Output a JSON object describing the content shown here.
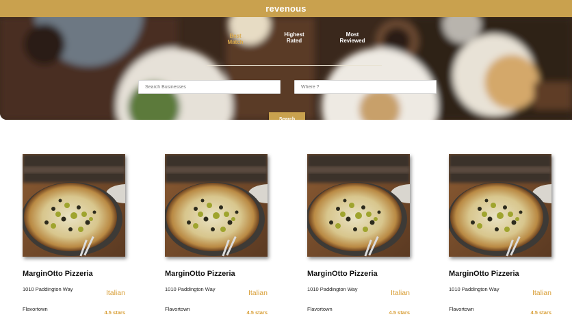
{
  "app": {
    "brand": "revenous"
  },
  "colors": {
    "accent": "#c9a14e",
    "active_tab": "#d9a84a",
    "cuisine": "#d9a03a"
  },
  "sort_tabs": [
    {
      "label": "Best\nMatch",
      "active": true
    },
    {
      "label": "Highest\nRated",
      "active": false
    },
    {
      "label": "Most\nReviewed",
      "active": false
    }
  ],
  "search": {
    "business_placeholder": "Search Businesses",
    "location_placeholder": "Where ?",
    "button_label": "Search"
  },
  "businesses": [
    {
      "name": "MarginOtto Pizzeria",
      "address": "1010 Paddington Way",
      "city": "Flavortown",
      "cuisine": "Italian",
      "rating": "4.5 stars",
      "image": "pizza-photo"
    },
    {
      "name": "MarginOtto Pizzeria",
      "address": "1010 Paddington Way",
      "city": "Flavortown",
      "cuisine": "Italian",
      "rating": "4.5 stars",
      "image": "pizza-photo"
    },
    {
      "name": "MarginOtto Pizzeria",
      "address": "1010 Paddington Way",
      "city": "Flavortown",
      "cuisine": "Italian",
      "rating": "4.5 stars",
      "image": "pizza-photo"
    },
    {
      "name": "MarginOtto Pizzeria",
      "address": "1010 Paddington Way",
      "city": "Flavortown",
      "cuisine": "Italian",
      "rating": "4.5 stars",
      "image": "pizza-photo"
    }
  ]
}
